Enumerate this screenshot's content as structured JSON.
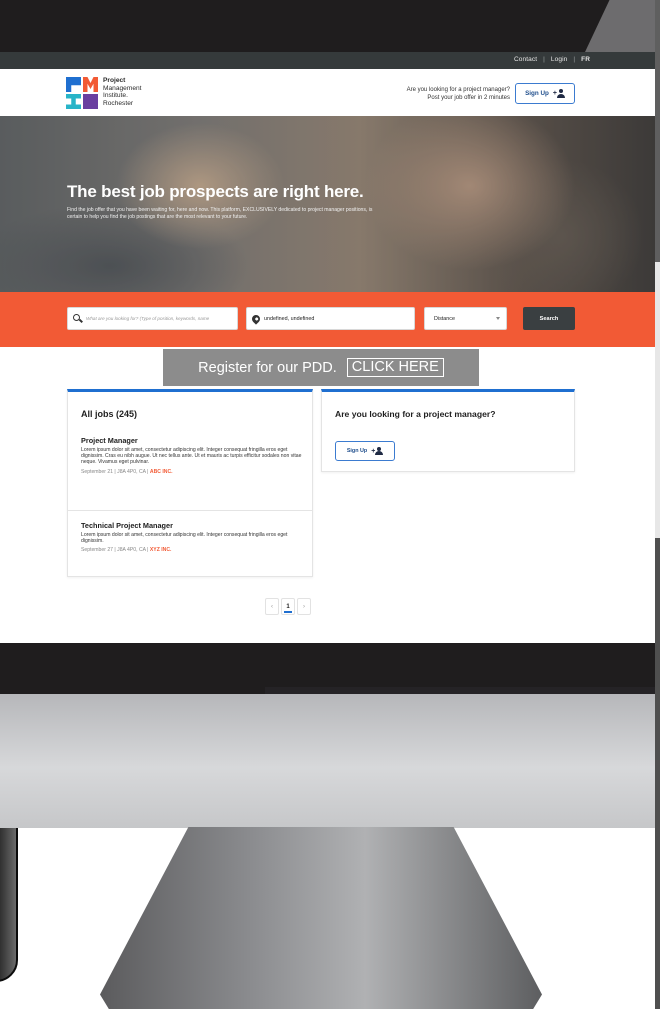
{
  "topbar": {
    "links": [
      "Contact",
      "Login",
      "FR"
    ]
  },
  "header": {
    "logo_lines": [
      "Project",
      "Management",
      "Institute.",
      "Rochester"
    ],
    "cta_line1": "Are you looking for a project manager?",
    "cta_line2": "Post your job offer in 2 minutes",
    "signup_label": "Sign Up"
  },
  "hero": {
    "title": "The best job prospects are right here.",
    "subtitle": "Find the job offer that you have been waiting for, here and now. This platform, EXCLUSIVELY dedicated to project manager positions, is certain to help you find the job postings that are the most relevant to your future."
  },
  "search": {
    "keyword_placeholder": "What are you looking for? (Type of position, keywords, name",
    "location_value": "undefined, undefined",
    "distance_label": "Distance",
    "button_label": "Search"
  },
  "banner": {
    "text": "Register for our PDD.",
    "link": "CLICK HERE"
  },
  "jobs": {
    "title": "All jobs (245)",
    "items": [
      {
        "title": "Project Manager",
        "description": "Lorem ipsum dolor sit amet, consectetur adipiscing elit. Integer consequat fringilla eros eget dignissim. Cras eu nibh augue. Ut nec tellus ante. Ut et mauris ac turpis efficitur sodales non vitae neque. Vivamus eget pulvinar.",
        "meta": "September 21 | J8A 4P0, CA | ",
        "company": "ABC INC."
      },
      {
        "title": "Technical Project Manager",
        "description": "Lorem ipsum dolor sit amet, consectetur adipiscing elit. Integer consequat fringilla eros eget dignissim.",
        "meta": "September 27 | J8A 4P0, CA | ",
        "company": "XYZ INC."
      }
    ]
  },
  "pm_card": {
    "title": "Are you looking for a project manager?",
    "signup_label": "Sign Up"
  },
  "pagination": {
    "prev": "‹",
    "current": "1",
    "next": "›"
  },
  "colors": {
    "accent_orange": "#f25a35",
    "accent_blue": "#1f6fd0",
    "topbar": "#353a3b",
    "banner_gray": "#8c8c8c"
  },
  "icons": [
    "search-icon",
    "location-pin-icon",
    "chevron-down-icon",
    "add-person-icon"
  ]
}
